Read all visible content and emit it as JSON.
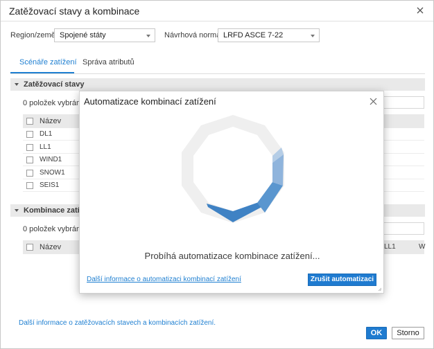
{
  "window": {
    "title": "Zatěžovací stavy a kombinace"
  },
  "filters": {
    "region_label": "Region/země:",
    "region_value": "Spojené státy",
    "norm_label": "Návrhová norma:",
    "norm_value": "LRFD ASCE 7-22"
  },
  "tabs": [
    {
      "label": "Scénáře zatížení"
    },
    {
      "label": "Správa atributů"
    }
  ],
  "load_cases": {
    "section_title": "Zatěžovací stavy",
    "selected_count": "0 položek vybráno",
    "column_name": "Název",
    "rows": [
      "DL1",
      "LL1",
      "WIND1",
      "SNOW1",
      "SEIS1"
    ]
  },
  "combinations": {
    "section_title": "Kombinace zatížení",
    "selected_count": "0 položek vybráno",
    "column_name": "Název",
    "extra_columns": [
      "LL1",
      "W"
    ]
  },
  "footer": {
    "info_link": "Další informace o zatěžovacích stavech a kombinacích zatížení.",
    "ok_label": "OK",
    "cancel_label": "Storno"
  },
  "modal": {
    "title": "Automatizace kombinací zatížení",
    "status": "Probíhá automatizace kombinace zatížení...",
    "info_link": "Další informace o automatizaci kombinací zatížení",
    "cancel_button": "Zrušit automatizaci"
  },
  "colors": {
    "accent": "#1f7bd0",
    "link": "#1e7fd1",
    "spinner_track": "#efefef",
    "spinner_dark": "#3f82c4",
    "spinner_light": "#b5cde6"
  }
}
